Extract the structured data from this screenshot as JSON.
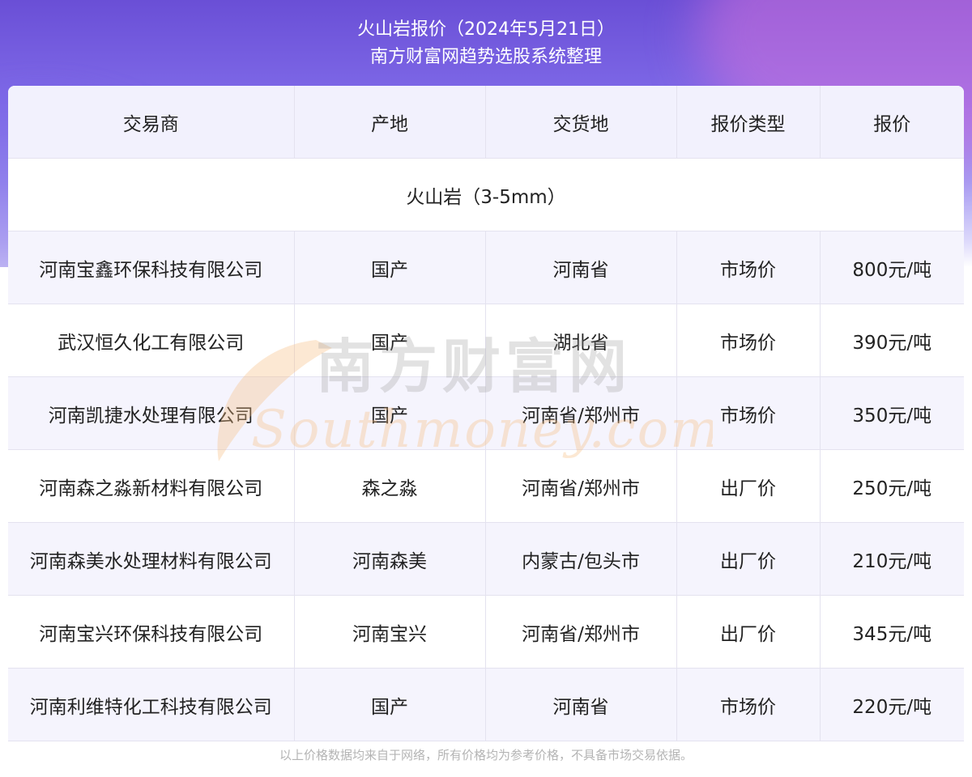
{
  "header": {
    "title": "火山岩报价（2024年5月21日）",
    "subtitle": "南方财富网趋势选股系统整理"
  },
  "table": {
    "columns": [
      "交易商",
      "产地",
      "交货地",
      "报价类型",
      "报价"
    ],
    "category": "火山岩（3-5mm）",
    "rows": [
      [
        "河南宝鑫环保科技有限公司",
        "国产",
        "河南省",
        "市场价",
        "800元/吨"
      ],
      [
        "武汉恒久化工有限公司",
        "国产",
        "湖北省",
        "市场价",
        "390元/吨"
      ],
      [
        "河南凯捷水处理有限公司",
        "国产",
        "河南省/郑州市",
        "市场价",
        "350元/吨"
      ],
      [
        "河南森之淼新材料有限公司",
        "森之淼",
        "河南省/郑州市",
        "出厂价",
        "250元/吨"
      ],
      [
        "河南森美水处理材料有限公司",
        "河南森美",
        "内蒙古/包头市",
        "出厂价",
        "210元/吨"
      ],
      [
        "河南宝兴环保科技有限公司",
        "河南宝兴",
        "河南省/郑州市",
        "出厂价",
        "345元/吨"
      ],
      [
        "河南利维特化工科技有限公司",
        "国产",
        "河南省",
        "市场价",
        "220元/吨"
      ]
    ]
  },
  "watermark": {
    "cn": "南方财富网",
    "en": "Southmoney.com"
  },
  "footer": {
    "note": "以上价格数据均来自于网络，所有价格均为参考价格，不具备市场交易依据。"
  },
  "colors": {
    "header_gradient_top": "#6a4fd6",
    "header_row_bg": "#f2f1fd",
    "striped_row_bg": "#f5f4fd",
    "grid_line": "#e4e2ef",
    "text": "#222222",
    "footer_text": "#b4b4b4"
  }
}
